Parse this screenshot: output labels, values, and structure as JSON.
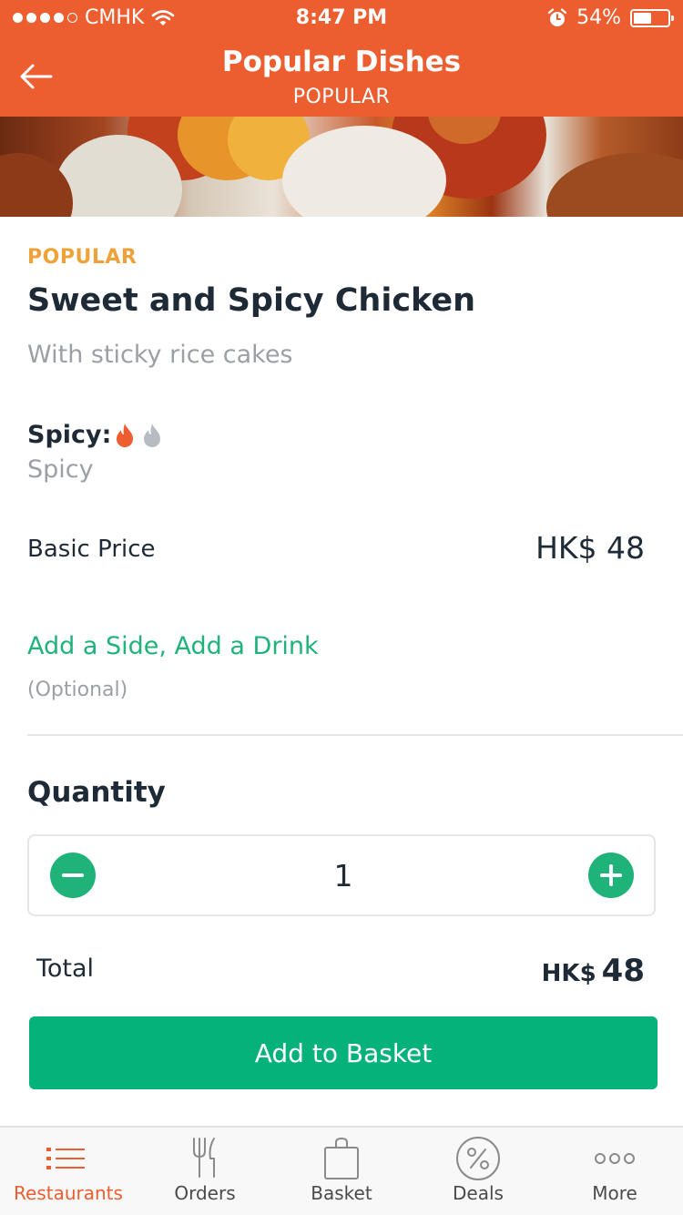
{
  "status_bar": {
    "carrier": "CMHK",
    "time": "8:47 PM",
    "battery": "54%",
    "signal_bars_filled": 4,
    "battery_level": 0.54
  },
  "header": {
    "title": "Popular Dishes",
    "subtitle": "POPULAR",
    "back_icon": "arrow-left-icon"
  },
  "dish": {
    "category": "POPULAR",
    "name": "Sweet and Spicy Chicken",
    "description": "With sticky rice cakes",
    "spicy_label": "Spicy:",
    "spicy_value": "Spicy",
    "spicy_level": 1,
    "spicy_max": 2,
    "price_label": "Basic Price",
    "price_value": "HK$ 48"
  },
  "addons": {
    "link_label": "Add a Side, Add a Drink",
    "note": "(Optional)"
  },
  "quantity": {
    "label": "Quantity",
    "value": "1"
  },
  "total": {
    "label": "Total",
    "currency": "HK$",
    "amount": "48"
  },
  "add_button_label": "Add to Basket",
  "tabs": [
    {
      "label": "Restaurants",
      "icon": "list-icon",
      "active": true
    },
    {
      "label": "Orders",
      "icon": "fork-knife-icon",
      "active": false
    },
    {
      "label": "Basket",
      "icon": "shopping-bag-icon",
      "active": false
    },
    {
      "label": "Deals",
      "icon": "percent-icon",
      "active": false
    },
    {
      "label": "More",
      "icon": "more-dots-icon",
      "active": false
    }
  ],
  "colors": {
    "brand_orange": "#ec5d2f",
    "accent_green": "#05b27a",
    "tag_yellow": "#f0a23a",
    "muted_gray": "#9aa0a6"
  }
}
